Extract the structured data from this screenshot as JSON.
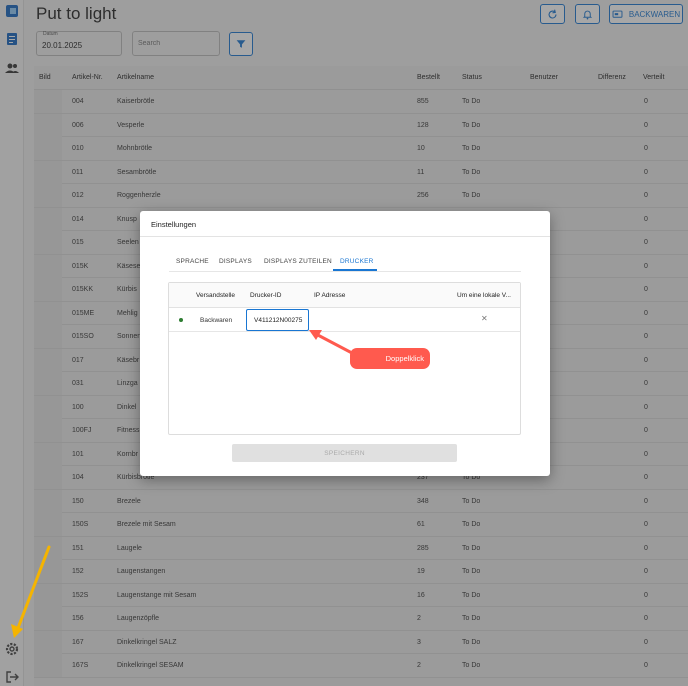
{
  "page": {
    "title": "Put to light"
  },
  "toolbar": {
    "backwaren_label": "BACKWAREN"
  },
  "filters": {
    "date_label": "Datum",
    "date_value": "20.01.2025",
    "search_placeholder": "Search"
  },
  "table": {
    "headers": [
      "Bild",
      "Artikel-Nr.",
      "Artikelname",
      "Bestellt",
      "Status",
      "Benutzer",
      "Differenz",
      "Verteilt"
    ],
    "rows": [
      {
        "nr": "004",
        "name": "Kaiserbrötle",
        "bestellt": "855",
        "status": "To Do",
        "verteilt": "0"
      },
      {
        "nr": "006",
        "name": "Vesperle",
        "bestellt": "128",
        "status": "To Do",
        "verteilt": "0"
      },
      {
        "nr": "010",
        "name": "Mohnbrötle",
        "bestellt": "10",
        "status": "To Do",
        "verteilt": "0"
      },
      {
        "nr": "011",
        "name": "Sesambrötle",
        "bestellt": "11",
        "status": "To Do",
        "verteilt": "0"
      },
      {
        "nr": "012",
        "name": "Roggenherzle",
        "bestellt": "256",
        "status": "To Do",
        "verteilt": "0"
      },
      {
        "nr": "014",
        "name": "Knusp",
        "bestellt": "",
        "status": "",
        "verteilt": "0"
      },
      {
        "nr": "015",
        "name": "Seelen",
        "bestellt": "",
        "status": "",
        "verteilt": "0"
      },
      {
        "nr": "015K",
        "name": "Käsese",
        "bestellt": "",
        "status": "",
        "verteilt": "0"
      },
      {
        "nr": "015KK",
        "name": "Kürbis",
        "bestellt": "",
        "status": "",
        "verteilt": "0"
      },
      {
        "nr": "015ME",
        "name": "Mehlig",
        "bestellt": "",
        "status": "",
        "verteilt": "0"
      },
      {
        "nr": "015SO",
        "name": "Sonnen",
        "bestellt": "",
        "status": "",
        "verteilt": "0"
      },
      {
        "nr": "017",
        "name": "Käsebr",
        "bestellt": "",
        "status": "",
        "verteilt": "0"
      },
      {
        "nr": "031",
        "name": "Linzga",
        "bestellt": "",
        "status": "",
        "verteilt": "0"
      },
      {
        "nr": "100",
        "name": "Dinkel",
        "bestellt": "",
        "status": "",
        "verteilt": "0"
      },
      {
        "nr": "100FJ",
        "name": "Fitness",
        "bestellt": "",
        "status": "",
        "verteilt": "0"
      },
      {
        "nr": "101",
        "name": "Kornbr",
        "bestellt": "",
        "status": "",
        "verteilt": "0"
      },
      {
        "nr": "104",
        "name": "Kürbisbrötle",
        "bestellt": "237",
        "status": "To Do",
        "verteilt": "0"
      },
      {
        "nr": "150",
        "name": "Brezele",
        "bestellt": "348",
        "status": "To Do",
        "verteilt": "0"
      },
      {
        "nr": "150S",
        "name": "Brezele mit Sesam",
        "bestellt": "61",
        "status": "To Do",
        "verteilt": "0"
      },
      {
        "nr": "151",
        "name": "Laugele",
        "bestellt": "285",
        "status": "To Do",
        "verteilt": "0"
      },
      {
        "nr": "152",
        "name": "Laugenstangen",
        "bestellt": "19",
        "status": "To Do",
        "verteilt": "0"
      },
      {
        "nr": "152S",
        "name": "Laugenstange mit Sesam",
        "bestellt": "16",
        "status": "To Do",
        "verteilt": "0"
      },
      {
        "nr": "156",
        "name": "Laugenzöpfle",
        "bestellt": "2",
        "status": "To Do",
        "verteilt": "0"
      },
      {
        "nr": "167",
        "name": "Dinkelkringel SALZ",
        "bestellt": "3",
        "status": "To Do",
        "verteilt": "0"
      },
      {
        "nr": "167S",
        "name": "Dinkelkringel SESAM",
        "bestellt": "2",
        "status": "To Do",
        "verteilt": "0"
      }
    ]
  },
  "dialog": {
    "title": "Einstellungen",
    "tabs": [
      "SPRACHE",
      "DISPLAYS",
      "DISPLAYS ZUTEILEN",
      "DRUCKER"
    ],
    "active_tab": "DRUCKER",
    "grid_headers": [
      "Versandstelle",
      "Drucker-ID",
      "IP Adresse",
      "Um eine lokale V..."
    ],
    "grid_row": {
      "versandstelle": "Backwaren",
      "drucker_id": "V411212N00275",
      "status_color": "#2e7d32"
    },
    "save_label": "SPEICHERN"
  },
  "annotation": {
    "callout_text": "Doppelklick",
    "callout_color": "#ff5a4e",
    "arrow_color": "#f5b400"
  },
  "colors": {
    "accent": "#1976d2"
  },
  "icons": [
    "app-logo-icon",
    "document-icon",
    "users-icon",
    "gear-icon",
    "logout-icon",
    "refresh-icon",
    "bell-icon",
    "monitor-icon",
    "filter-icon",
    "close-icon"
  ]
}
